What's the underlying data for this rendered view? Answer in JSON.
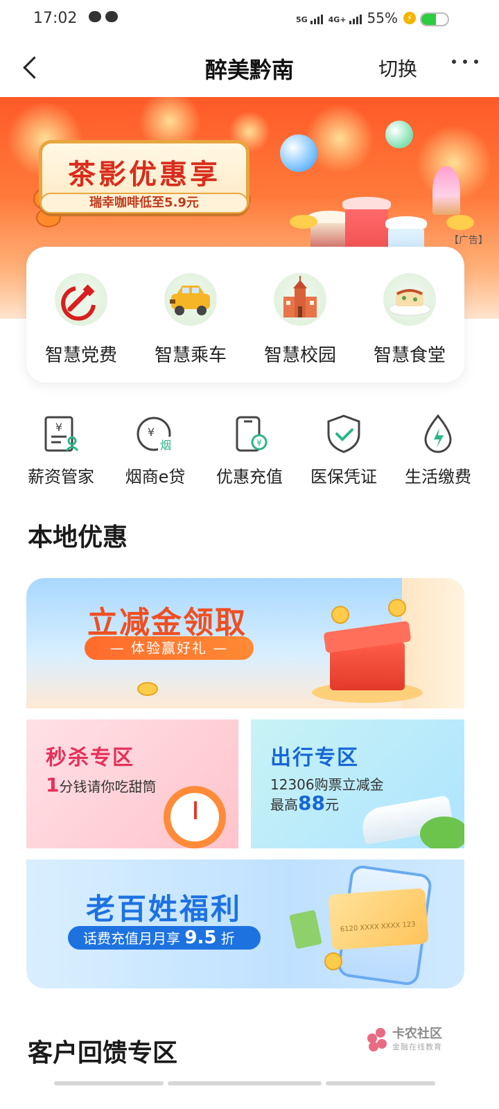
{
  "status_bar": {
    "time": "17:02",
    "network_1": "5G",
    "network_2": "4G+",
    "battery_percent": "55%",
    "battery_level": 0.55,
    "icons": [
      "cloud-icon",
      "chat-icon",
      "signal-icon",
      "charging-icon",
      "battery-icon"
    ]
  },
  "nav": {
    "back_icon": "chevron-left-icon",
    "title": "醉美黔南",
    "switch_label": "切换",
    "more_icon": "more-icon"
  },
  "banner": {
    "title": "茶影优惠享",
    "subtitle": "瑞幸咖啡低至5.9元",
    "ad_tag": "【广告】",
    "brand_accent": "#ff5a28"
  },
  "quick_services": [
    {
      "label": "智慧党费",
      "icon": "party-emblem-icon"
    },
    {
      "label": "智慧乘车",
      "icon": "taxi-icon"
    },
    {
      "label": "智慧校园",
      "icon": "school-icon"
    },
    {
      "label": "智慧食堂",
      "icon": "food-icon"
    }
  ],
  "services": [
    {
      "label": "薪资管家",
      "icon": "salary-document-icon"
    },
    {
      "label": "烟商e贷",
      "icon": "tobacco-loan-icon"
    },
    {
      "label": "优惠充值",
      "icon": "phone-recharge-icon"
    },
    {
      "label": "医保凭证",
      "icon": "shield-check-icon"
    },
    {
      "label": "生活缴费",
      "icon": "utility-drop-icon"
    }
  ],
  "local_offers": {
    "section_title": "本地优惠",
    "main": {
      "title": "立减金领取",
      "pill": "— 体验赢好礼 —"
    },
    "flash_sale": {
      "title": "秒杀专区",
      "highlight": "1",
      "text": "分钱请你吃甜筒"
    },
    "travel": {
      "title": "出行专区",
      "line1": "12306购票立减金",
      "line2_prefix": "最高",
      "line2_amount": "88",
      "line2_suffix": "元"
    },
    "welfare": {
      "title": "老百姓福利",
      "pill_prefix": "话费充值月月享 ",
      "pill_amount": "9.5",
      "pill_suffix": " 折",
      "card_number": "6120 XXXX XXXX 123"
    }
  },
  "feedback": {
    "section_title": "客户回馈专区"
  },
  "watermark": {
    "name": "卡农社区",
    "sub": "金融在线教育"
  }
}
